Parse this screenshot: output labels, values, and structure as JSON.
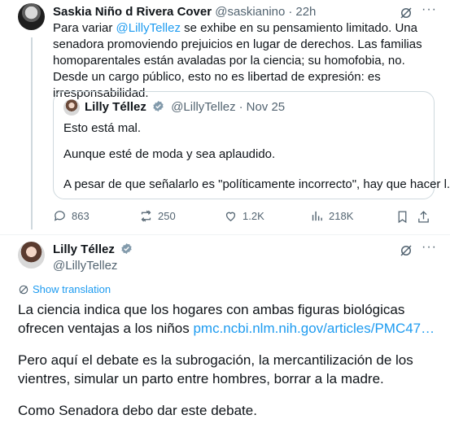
{
  "reply": {
    "author_name": "Saskia Niño d Rivera Cover",
    "handle": "@saskianino",
    "time": "22h",
    "text_before": "Para variar ",
    "mention": "@LillyTellez",
    "text_after": " se exhibe en su pensamiento limitado. Una senadora promoviendo prejuicios en lugar de derechos. Las familias homoparentales están avaladas por la ciencia; su homofobia, no. Desde un cargo público, esto no es libertad de expresión: es irresponsabilidad.",
    "quote": {
      "author_name": "Lilly Téllez",
      "handle": "@LillyTellez",
      "date": "Nov 25",
      "line1": "Esto está mal.",
      "line2": "Aunque esté de moda y sea aplaudido.",
      "line3": "A pesar de que señalarlo es \"políticamente incorrecto\", hay que hacer l..."
    },
    "stats": {
      "replies": "863",
      "reposts": "250",
      "likes": "1.2K",
      "views": "218K"
    }
  },
  "main": {
    "author_name": "Lilly Téllez",
    "handle": "@LillyTellez",
    "show_translation": "Show translation",
    "para1_text": "La ciencia indica que los hogares con ambas figuras biológicas ofrecen ventajas a los niños ",
    "para1_link": "pmc.ncbi.nlm.nih.gov/articles/PMC47…",
    "para2": "Pero aquí el debate es la subrogación, la mercantilización de los vientres, simular un parto entre hombres, borrar a la madre.",
    "para3": "Como Senadora debo dar este debate."
  },
  "colors": {
    "text": "#0f1419",
    "secondary": "#536471",
    "accent": "#1d9bf0",
    "border": "#cfd9de"
  }
}
